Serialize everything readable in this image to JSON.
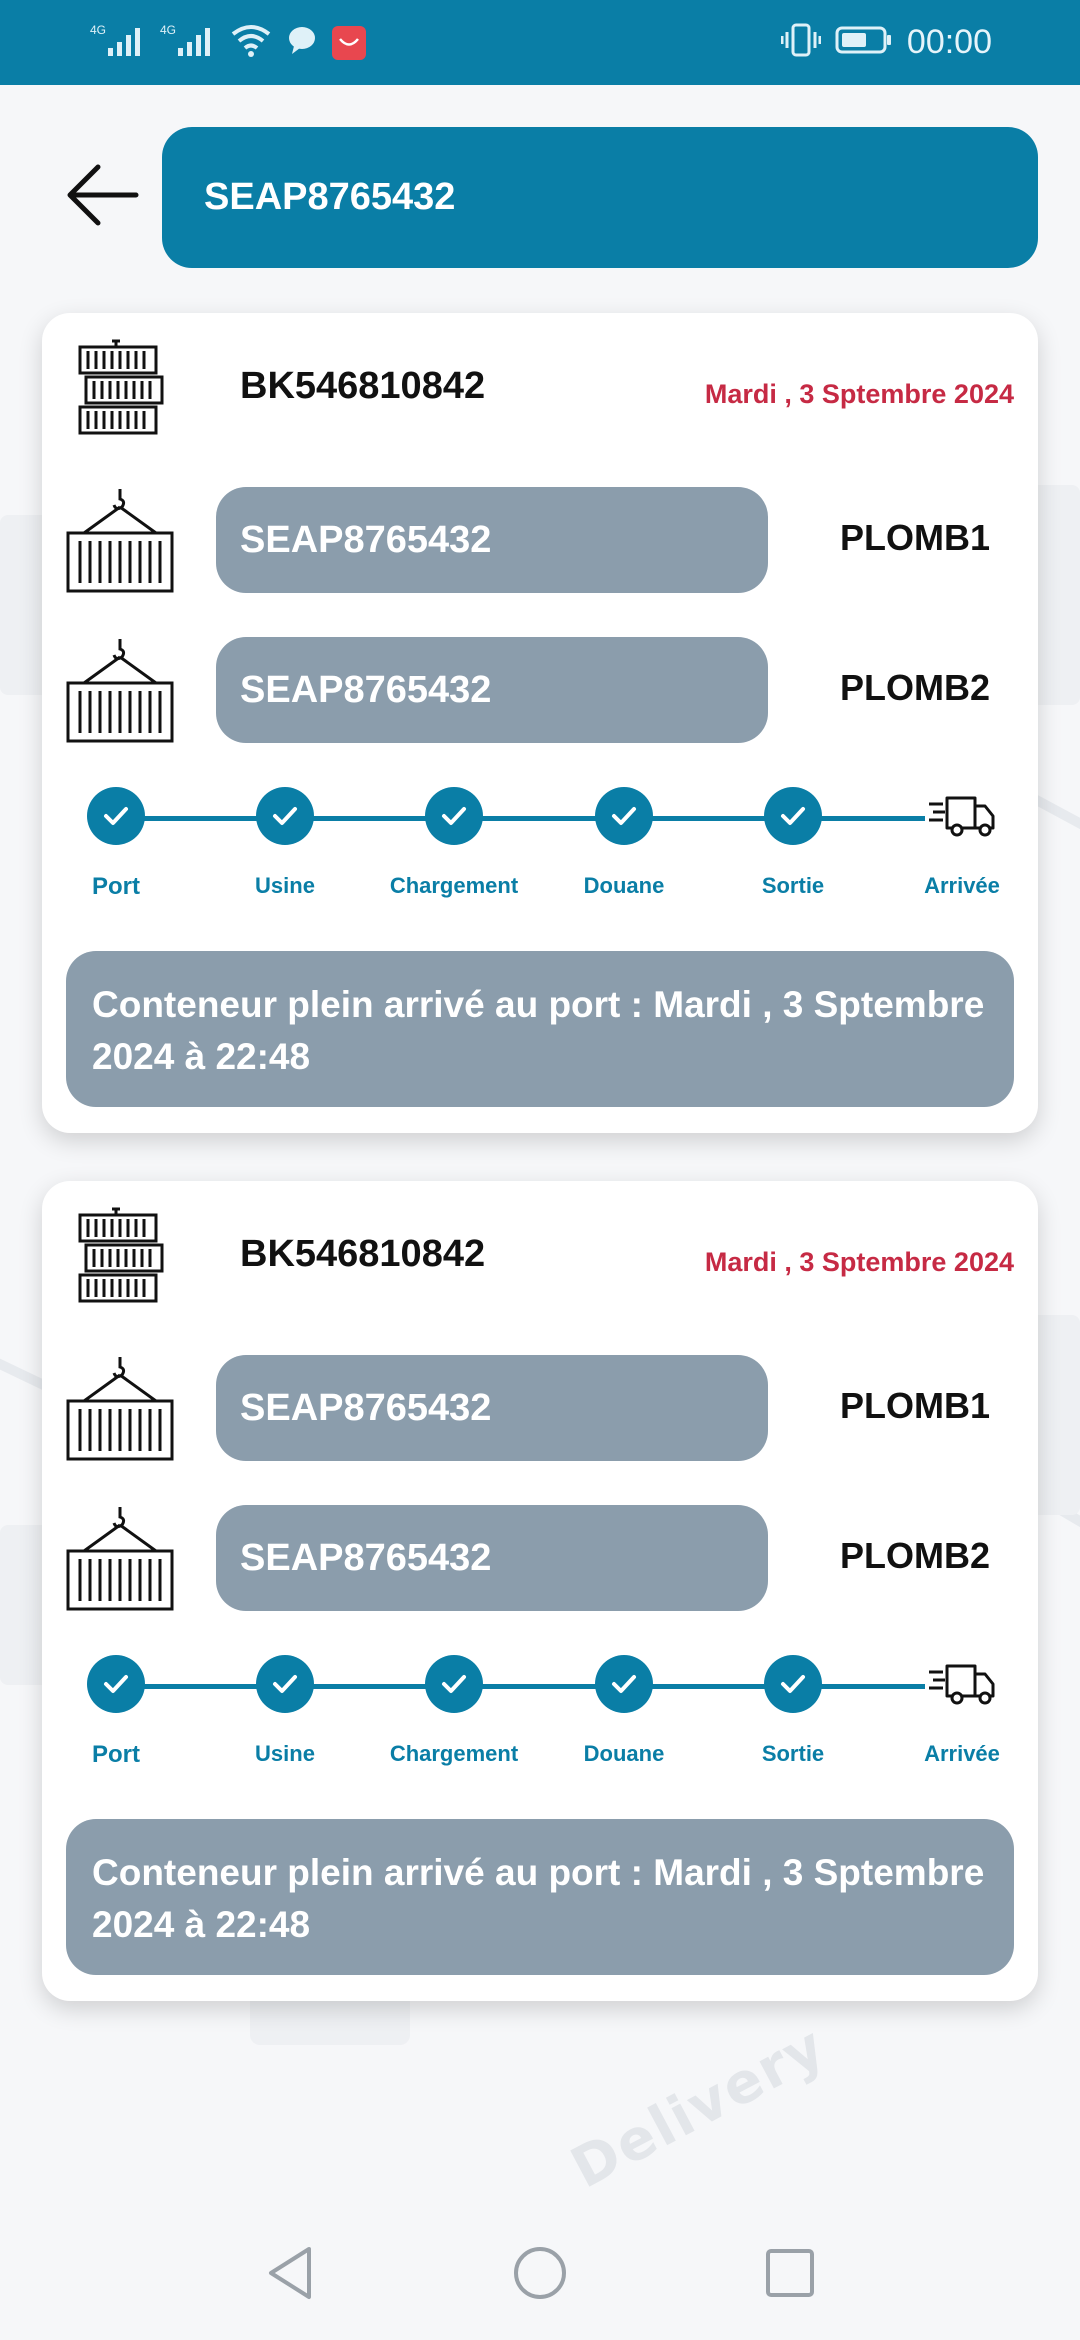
{
  "status_bar": {
    "network1": "4G",
    "network2": "4G",
    "time": "00:00",
    "icons": [
      "signal-icon",
      "signal-icon",
      "wifi-icon",
      "chat-bubble-icon",
      "huawei-app-icon",
      "vibrate-icon",
      "battery-icon"
    ]
  },
  "header": {
    "search_value": "SEAP8765432"
  },
  "cards": [
    {
      "booking": "BK546810842",
      "date": "Mardi , 3 Sptembre 2024",
      "seals": [
        {
          "value": "SEAP8765432",
          "label": "PLOMB1"
        },
        {
          "value": "SEAP8765432",
          "label": "PLOMB2"
        }
      ],
      "steps": [
        "Port",
        "Usine",
        "Chargement",
        "Douane",
        "Sortie",
        "Arrivée"
      ],
      "message": "Conteneur plein arrivé au port  : Mardi , 3 Sptembre 2024 à 22:48"
    },
    {
      "booking": "BK546810842",
      "date": "Mardi , 3 Sptembre 2024",
      "seals": [
        {
          "value": "SEAP8765432",
          "label": "PLOMB1"
        },
        {
          "value": "SEAP8765432",
          "label": "PLOMB2"
        }
      ],
      "steps": [
        "Port",
        "Usine",
        "Chargement",
        "Douane",
        "Sortie",
        "Arrivée"
      ],
      "message": "Conteneur plein arrivé au port  : Mardi , 3 Sptembre 2024 à 22:48"
    }
  ],
  "background": {
    "words": [
      "Delivery"
    ]
  },
  "colors": {
    "primary": "#0a7ea6",
    "pill": "#8b9dac",
    "date": "#c62a44"
  }
}
